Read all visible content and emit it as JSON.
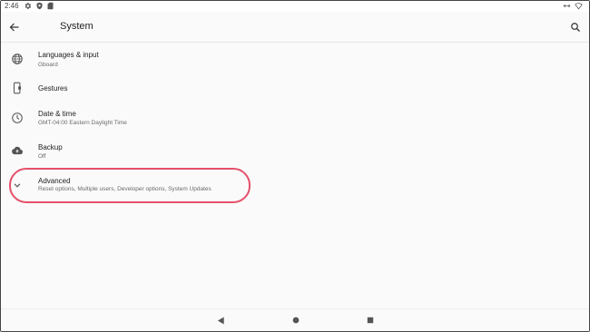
{
  "status_bar": {
    "time": "2:46",
    "icons": [
      "settings-icon",
      "shield-icon",
      "sd-card-icon",
      "data-arrows-icon",
      "wifi-icon"
    ]
  },
  "app_bar": {
    "back_icon": "arrow-back-icon",
    "title": "System",
    "search_icon": "search-icon"
  },
  "settings": [
    {
      "icon": "globe-icon",
      "title": "Languages & input",
      "summary": "Gboard"
    },
    {
      "icon": "gestures-phone-icon",
      "title": "Gestures",
      "summary": ""
    },
    {
      "icon": "clock-icon",
      "title": "Date & time",
      "summary": "GMT-04:00 Eastern Daylight Time"
    },
    {
      "icon": "cloud-backup-icon",
      "title": "Backup",
      "summary": "Off"
    },
    {
      "icon": "chevron-down-icon",
      "title": "Advanced",
      "summary": "Reset options, Multiple users, Developer options, System Updates"
    }
  ],
  "annotation": {
    "highlight_color": "#e5506a",
    "highlighted_item": "Advanced"
  },
  "nav_bar": {
    "icons": [
      "back-triangle-icon",
      "home-circle-icon",
      "recents-square-icon"
    ]
  }
}
